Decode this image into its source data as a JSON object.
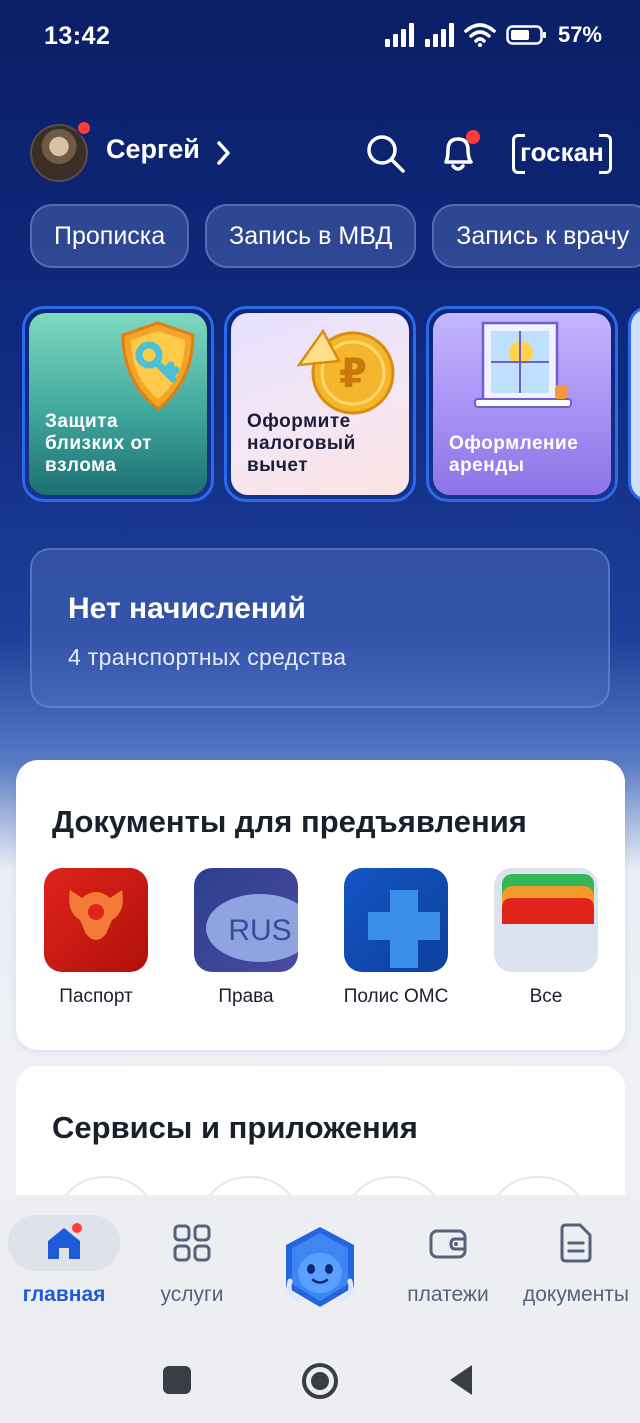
{
  "status_bar": {
    "time": "13:42",
    "battery_percent": "57%",
    "icons": [
      "signal-icon",
      "signal-icon",
      "wifi-icon",
      "battery-icon"
    ]
  },
  "header": {
    "user_name": "Сергей",
    "goscan_label": "госкан"
  },
  "chips": [
    "Прописка",
    "Запись в МВД",
    "Запись к врачу"
  ],
  "stories": [
    {
      "text": "Защита близких от взлома",
      "art": "shield-key-icon"
    },
    {
      "text": "Оформите налоговый вычет",
      "art": "coin-icon"
    },
    {
      "text": "Оформление аренды",
      "art": "window-icon"
    }
  ],
  "charges": {
    "title": "Нет начислений",
    "subtitle": "4 транспортных средства"
  },
  "documents": {
    "title": "Документы для предъявления",
    "items": [
      {
        "label": "Паспорт",
        "icon": "passport-eagle-icon"
      },
      {
        "label": "Права",
        "icon": "license-rus-icon",
        "icon_text": "RUS"
      },
      {
        "label": "Полис ОМС",
        "icon": "medical-cross-icon"
      },
      {
        "label": "Все",
        "icon": "wallet-cards-icon"
      }
    ]
  },
  "services": {
    "title": "Сервисы и приложения"
  },
  "tab_bar": {
    "tabs": [
      {
        "label": "главная",
        "icon": "home-icon",
        "active": true
      },
      {
        "label": "услуги",
        "icon": "grid-icon",
        "active": false
      },
      {
        "label": "",
        "icon": "robot-assistant-icon",
        "active": false
      },
      {
        "label": "платежи",
        "icon": "wallet-icon",
        "active": false
      },
      {
        "label": "документы",
        "icon": "document-icon",
        "active": false
      }
    ]
  },
  "colors": {
    "brand_dark": "#0b1f66",
    "accent": "#1d5bd8",
    "notification": "#ff3b3b"
  }
}
